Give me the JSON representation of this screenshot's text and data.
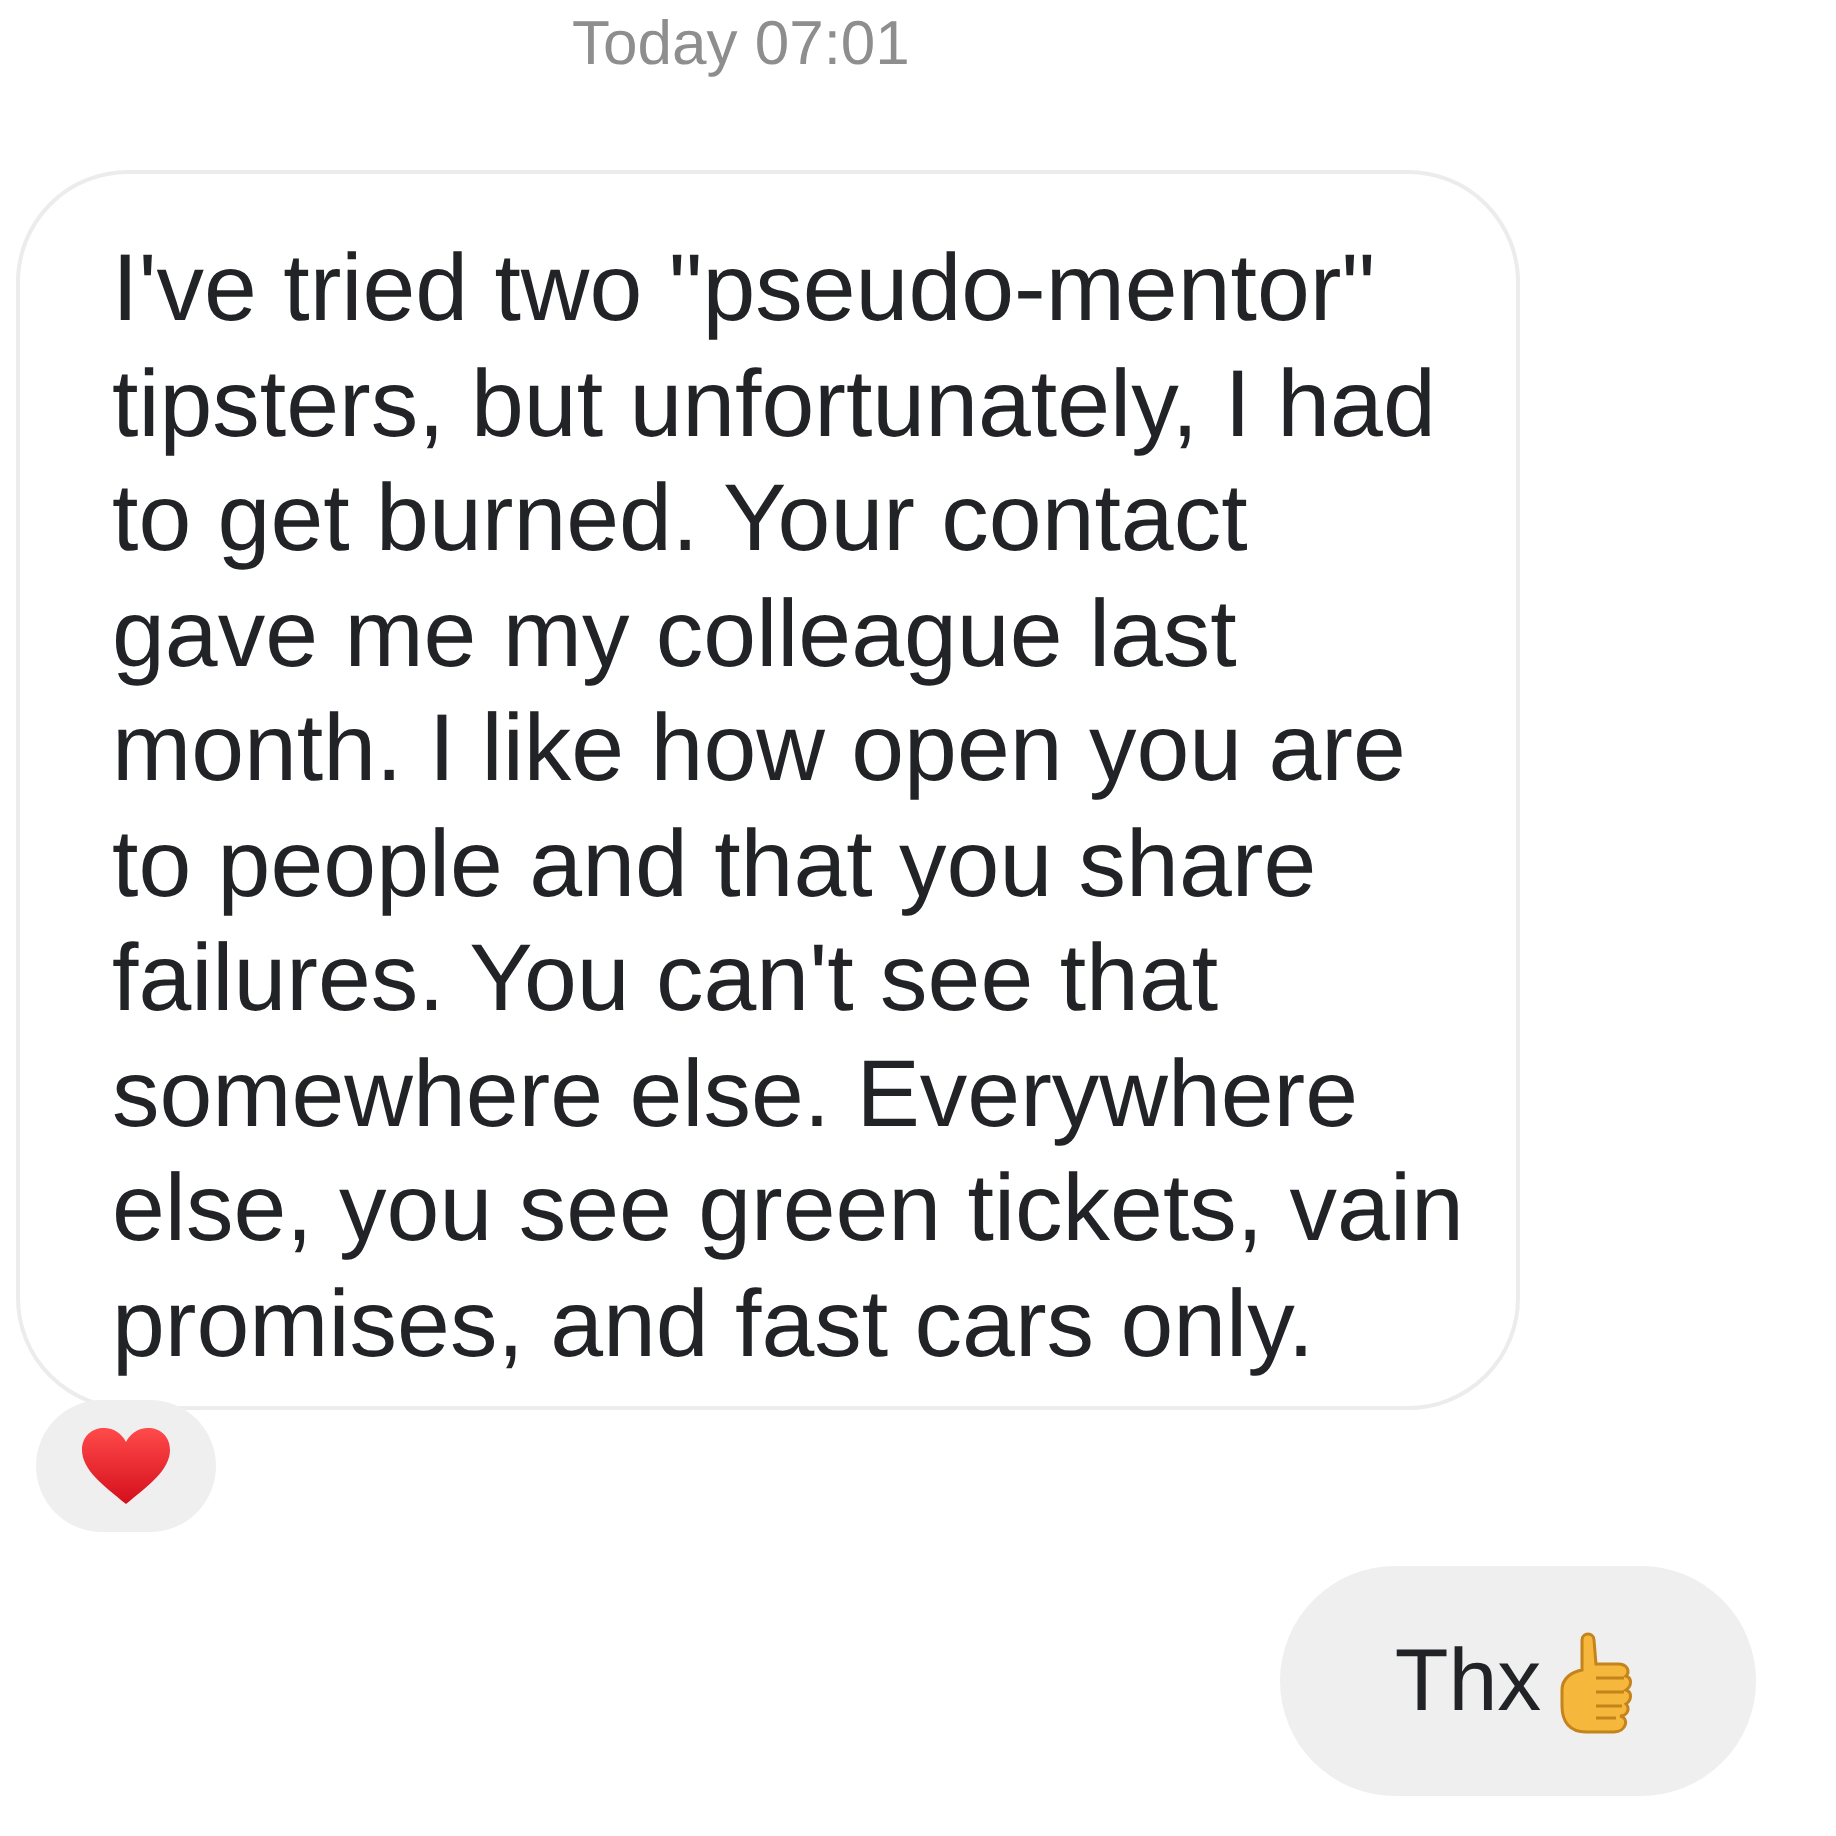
{
  "timestamp": {
    "day": "Today",
    "time": "07:01"
  },
  "messages": [
    {
      "kind": "received",
      "text": "I've tried two \"pseudo-mentor\" tipsters, but unfortunately, I had to get burned. Your contact gave me my colleague last month. I like how open you are to people and that you share failures. You can't see that somewhere else. Everywhere else, you see green tickets, vain promises, and fast cars only.",
      "reacted": true
    },
    {
      "kind": "sent",
      "text": "Thx",
      "reacted": false
    }
  ]
}
